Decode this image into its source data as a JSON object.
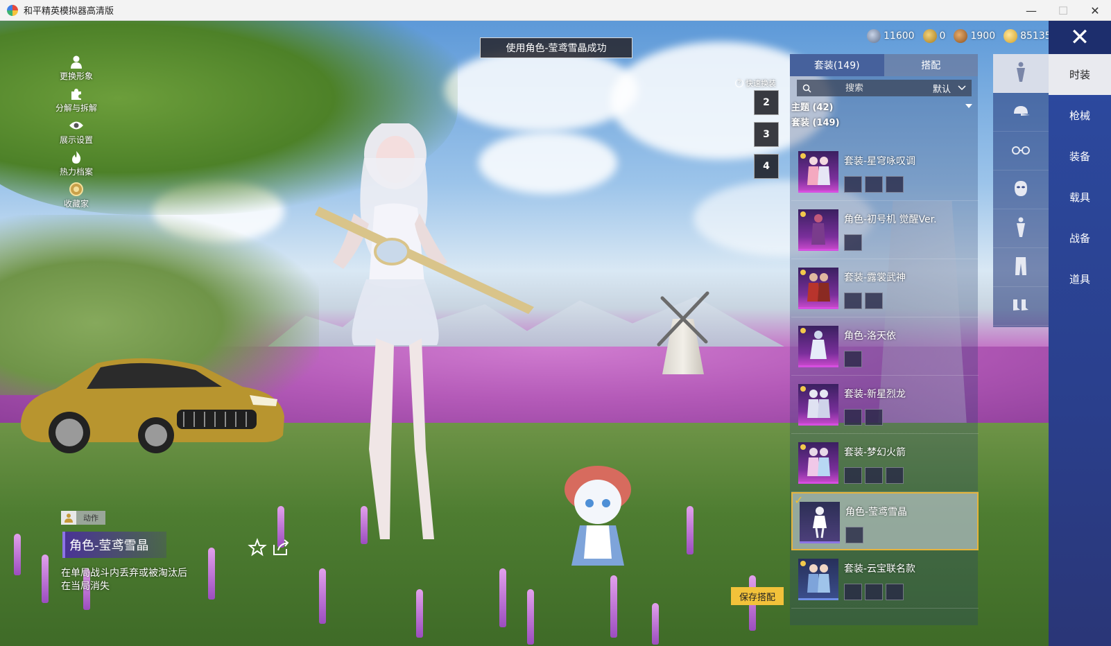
{
  "window": {
    "title": "和平精英模拟器高清版",
    "controls": {
      "minimize": "—",
      "maximize": "☐",
      "close": "✕"
    }
  },
  "left_tools": [
    {
      "label": "更换形象",
      "icon": "person-icon"
    },
    {
      "label": "分解与拆解",
      "icon": "puzzle-icon"
    },
    {
      "label": "展示设置",
      "icon": "eye-icon"
    },
    {
      "label": "热力档案",
      "icon": "flame-icon"
    },
    {
      "label": "收藏家",
      "icon": "medal-icon"
    }
  ],
  "toast": "使用角色-莹鸢雪晶成功",
  "currencies": [
    {
      "value": "11600",
      "icon": "globe-coin-icon",
      "color": "#7d8fb0"
    },
    {
      "value": "0",
      "icon": "gold-coin-icon",
      "color": "#c89b2d"
    },
    {
      "value": "1900",
      "icon": "bronze-coin-icon",
      "color": "#b7722e"
    },
    {
      "value": "85135",
      "icon": "yellow-coin-icon",
      "color": "#e7b93a"
    }
  ],
  "quick_change": {
    "label": "快速换装",
    "slots": [
      "2",
      "3",
      "4"
    ]
  },
  "tabs": [
    {
      "label": "套装(149)",
      "active": true
    },
    {
      "label": "搭配",
      "active": false
    }
  ],
  "search": {
    "placeholder": "搜索",
    "sort": "默认"
  },
  "filters": {
    "theme": "主题 (42)",
    "suit": "套装 (149)"
  },
  "outfits": [
    {
      "name": "套装-星穹咏叹调",
      "parts": 3,
      "selected": false
    },
    {
      "name": "角色-初号机 觉醒Ver.",
      "parts": 1,
      "selected": false
    },
    {
      "name": "套装-露裳武神",
      "parts": 2,
      "selected": false
    },
    {
      "name": "角色-洛天依",
      "parts": 1,
      "selected": false
    },
    {
      "name": "套装-新星烈龙",
      "parts": 2,
      "selected": false
    },
    {
      "name": "套装-梦幻火箭",
      "parts": 3,
      "selected": false
    },
    {
      "name": "角色-莹鸢雪晶",
      "parts": 1,
      "selected": true
    },
    {
      "name": "套装-云宝联名款",
      "parts": 3,
      "selected": false
    }
  ],
  "categories": [
    {
      "label": "时装",
      "active": true
    },
    {
      "label": "枪械",
      "active": false
    },
    {
      "label": "装备",
      "active": false
    },
    {
      "label": "载具",
      "active": false
    },
    {
      "label": "战备",
      "active": false
    },
    {
      "label": "道具",
      "active": false
    }
  ],
  "subcategories": [
    "full-body-icon",
    "cap-icon",
    "glasses-icon",
    "face-mask-icon",
    "outfit-icon",
    "pants-icon",
    "shoes-icon"
  ],
  "selected_item": {
    "action_label": "动作",
    "title": "角色-莹鸢雪晶",
    "description": "在单局战斗内丢弃或被淘汰后在当局消失"
  },
  "save_button": "保存搭配",
  "close_rail": "✕"
}
